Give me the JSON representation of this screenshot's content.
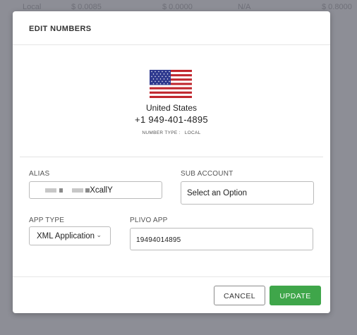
{
  "background_row": {
    "type": "Local",
    "cost1": "$ 0.0085",
    "cost2": "$ 0.0000",
    "status": "N/A",
    "cost3": "$ 0.8000"
  },
  "modal": {
    "title": "EDIT NUMBERS",
    "country": "United States",
    "number": "+1 949-401-4895",
    "number_type_label": "NUMBER TYPE :",
    "number_type_value": "LOCAL",
    "flag_icon": "us-flag-icon"
  },
  "form": {
    "alias_label": "ALIAS",
    "alias_value": "XcallY",
    "subaccount_label": "SUB ACCOUNT",
    "subaccount_value": "Select an Option",
    "apptype_label": "APP TYPE",
    "apptype_value": "XML Application",
    "plivoapp_label": "PLIVO APP",
    "plivoapp_value": "19494014895"
  },
  "footer": {
    "cancel_label": "CANCEL",
    "update_label": "UPDATE",
    "update_color": "#3fa64a"
  }
}
